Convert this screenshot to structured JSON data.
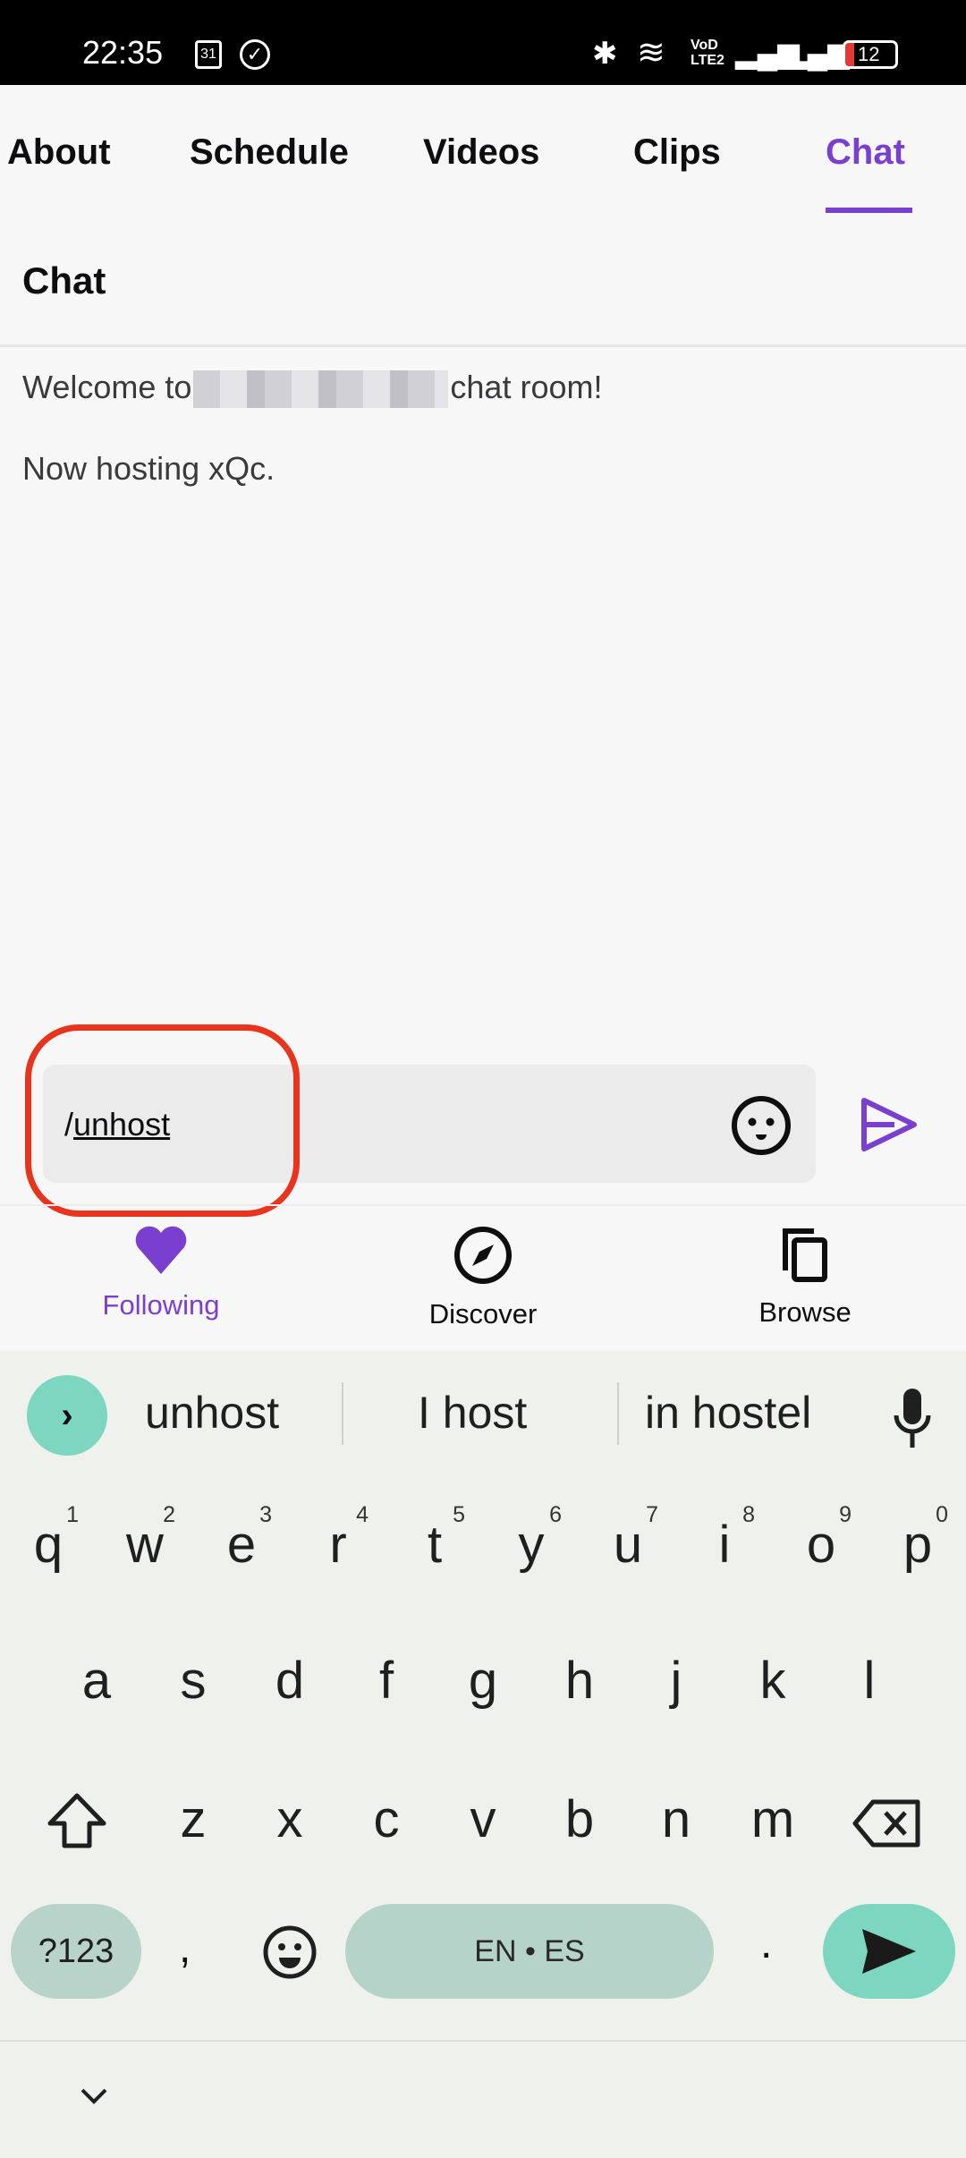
{
  "status_bar": {
    "time": "22:35",
    "calendar_badge": "31",
    "battery": "12"
  },
  "tabs": [
    {
      "label": "About"
    },
    {
      "label": "Schedule"
    },
    {
      "label": "Videos"
    },
    {
      "label": "Clips"
    },
    {
      "label": "Chat",
      "active": true
    }
  ],
  "chat": {
    "title": "Chat",
    "messages": [
      {
        "prefix": "Welcome to",
        "suffix": "chat room!"
      },
      {
        "text": "Now hosting xQc."
      }
    ],
    "input": {
      "slash": "/",
      "word": "unhost"
    }
  },
  "bottom_nav": [
    {
      "label": "Following",
      "icon": "heart-icon",
      "active": true
    },
    {
      "label": "Discover",
      "icon": "compass-icon"
    },
    {
      "label": "Browse",
      "icon": "browse-icon"
    }
  ],
  "keyboard": {
    "suggestions": [
      "unhost",
      "I host",
      "in hostel"
    ],
    "row1": [
      {
        "k": "q",
        "n": "1"
      },
      {
        "k": "w",
        "n": "2"
      },
      {
        "k": "e",
        "n": "3"
      },
      {
        "k": "r",
        "n": "4"
      },
      {
        "k": "t",
        "n": "5"
      },
      {
        "k": "y",
        "n": "6"
      },
      {
        "k": "u",
        "n": "7"
      },
      {
        "k": "i",
        "n": "8"
      },
      {
        "k": "o",
        "n": "9"
      },
      {
        "k": "p",
        "n": "0"
      }
    ],
    "row2": [
      "a",
      "s",
      "d",
      "f",
      "g",
      "h",
      "j",
      "k",
      "l"
    ],
    "row3": [
      "z",
      "x",
      "c",
      "v",
      "b",
      "n",
      "m"
    ],
    "symbols": "?123",
    "comma": ",",
    "space": "EN • ES",
    "period": "."
  },
  "colors": {
    "accent": "#7b3fcf",
    "highlight": "#e8341c",
    "kbd_accent": "#7dd6c0"
  }
}
